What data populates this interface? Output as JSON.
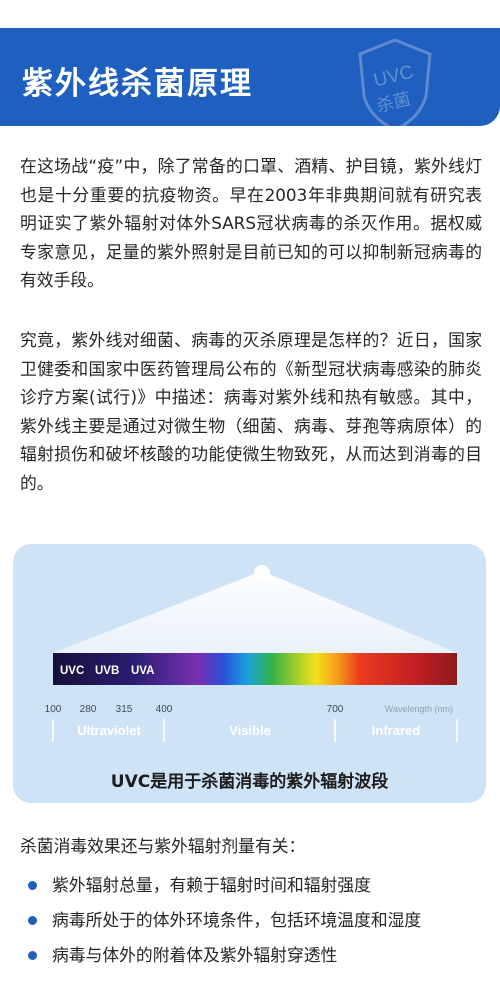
{
  "header": {
    "title": "紫外线杀菌原理",
    "badge_line1": "UVC",
    "badge_line2": "杀菌"
  },
  "paragraphs": [
    "在这场战“疫”中，除了常备的口罩、酒精、护目镜，紫外线灯也是十分重要的抗疫物资。早在2003年非典期间就有研究表明证实了紫外辐射对体外SARS冠状病毒的杀灭作用。据权威专家意见，足量的紫外照射是目前已知的可以抑制新冠病毒的有效手段。",
    "究竟，紫外线对细菌、病毒的灭杀原理是怎样的？近日，国家卫健委和国家中医药管理局公布的《新型冠状病毒感染的肺炎诊疗方案(试行)》中描述：病毒对紫外线和热有敏感。其中，紫外线主要是通过对微生物（细菌、病毒、芽孢等病原体）的辐射损伤和破坏核酸的功能使微生物致死，从而达到消毒的目的。"
  ],
  "spectrum": {
    "band_labels": [
      "UVC",
      "UVB",
      "UVA"
    ],
    "ticks": [
      "100",
      "280",
      "315",
      "400",
      "700"
    ],
    "axis_unit": "Wavelength (nm)",
    "regions": [
      "Ultraviolet",
      "Visible",
      "Infrared"
    ],
    "caption": "UVC是用于杀菌消毒的紫外辐射波段"
  },
  "summary": "杀菌消毒效果还与紫外辐射剂量有关：",
  "bullets": [
    "紫外辐射总量，有赖于辐射时间和辐射强度",
    "病毒所处于的体外环境条件，包括环境温度和湿度",
    "病毒与体外的附着体及紫外辐射穿透性"
  ],
  "colors": {
    "header_blue": "#1e5fc0",
    "panel_blue": "#cfe3f7",
    "bullet_blue": "#1e5fc0"
  }
}
